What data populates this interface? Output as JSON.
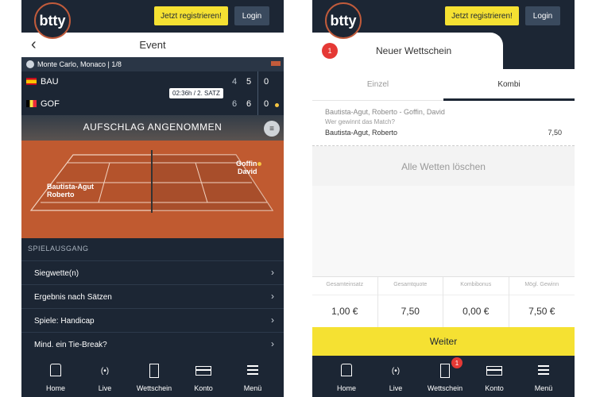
{
  "header": {
    "logo": "btty",
    "register_label": "Jetzt registrieren!",
    "login_label": "Login"
  },
  "event": {
    "title": "Event",
    "location": "Monte Carlo, Monaco | 1/8",
    "timer": "02:36h  /  2. SATZ",
    "teams": [
      {
        "code": "BAU",
        "s1": "4",
        "s2": "5",
        "s3": "0"
      },
      {
        "code": "GOF",
        "s1": "6",
        "s2": "6",
        "s3": "0"
      }
    ],
    "serve_banner": "AUFSCHLAG ANGENOMMEN",
    "players": {
      "left": "Bautista-Agut\nRoberto",
      "right": "Goffin\nDavid"
    }
  },
  "outcomes": {
    "heading": "SPIELAUSGANG",
    "items": [
      {
        "label": "Siegwette(n)"
      },
      {
        "label": "Ergebnis nach Sätzen"
      },
      {
        "label": "Spiele: Handicap"
      },
      {
        "label": "Mind. ein Tie-Break?"
      }
    ]
  },
  "nav": {
    "items": [
      {
        "label": "Home"
      },
      {
        "label": "Live",
        "icon_glyph": "(•)"
      },
      {
        "label": "Wettschein"
      },
      {
        "label": "Konto"
      },
      {
        "label": "Menü"
      }
    ],
    "slip_badge": "1"
  },
  "slip": {
    "badge": "1",
    "title": "Neuer Wettschein",
    "tabs": [
      "Einzel",
      "Kombi"
    ],
    "match": "Bautista-Agut, Roberto - Goffin, David",
    "question": "Wer gewinnt das Match?",
    "pick": "Bautista-Agut, Roberto",
    "odd": "7,50",
    "clear_all": "Alle Wetten löschen",
    "totals": [
      {
        "label": "Gesamteinsatz",
        "value": "1,00 €"
      },
      {
        "label": "Gesamtquote",
        "value": "7,50"
      },
      {
        "label": "Kombibonus",
        "value": "0,00 €"
      },
      {
        "label": "Mögl. Gewinn",
        "value": "7,50 €"
      }
    ],
    "continue_label": "Weiter"
  },
  "colors": {
    "navy": "#1c2634",
    "yellow": "#f5e132",
    "clay": "#c05a30",
    "badge_red": "#e53935"
  }
}
